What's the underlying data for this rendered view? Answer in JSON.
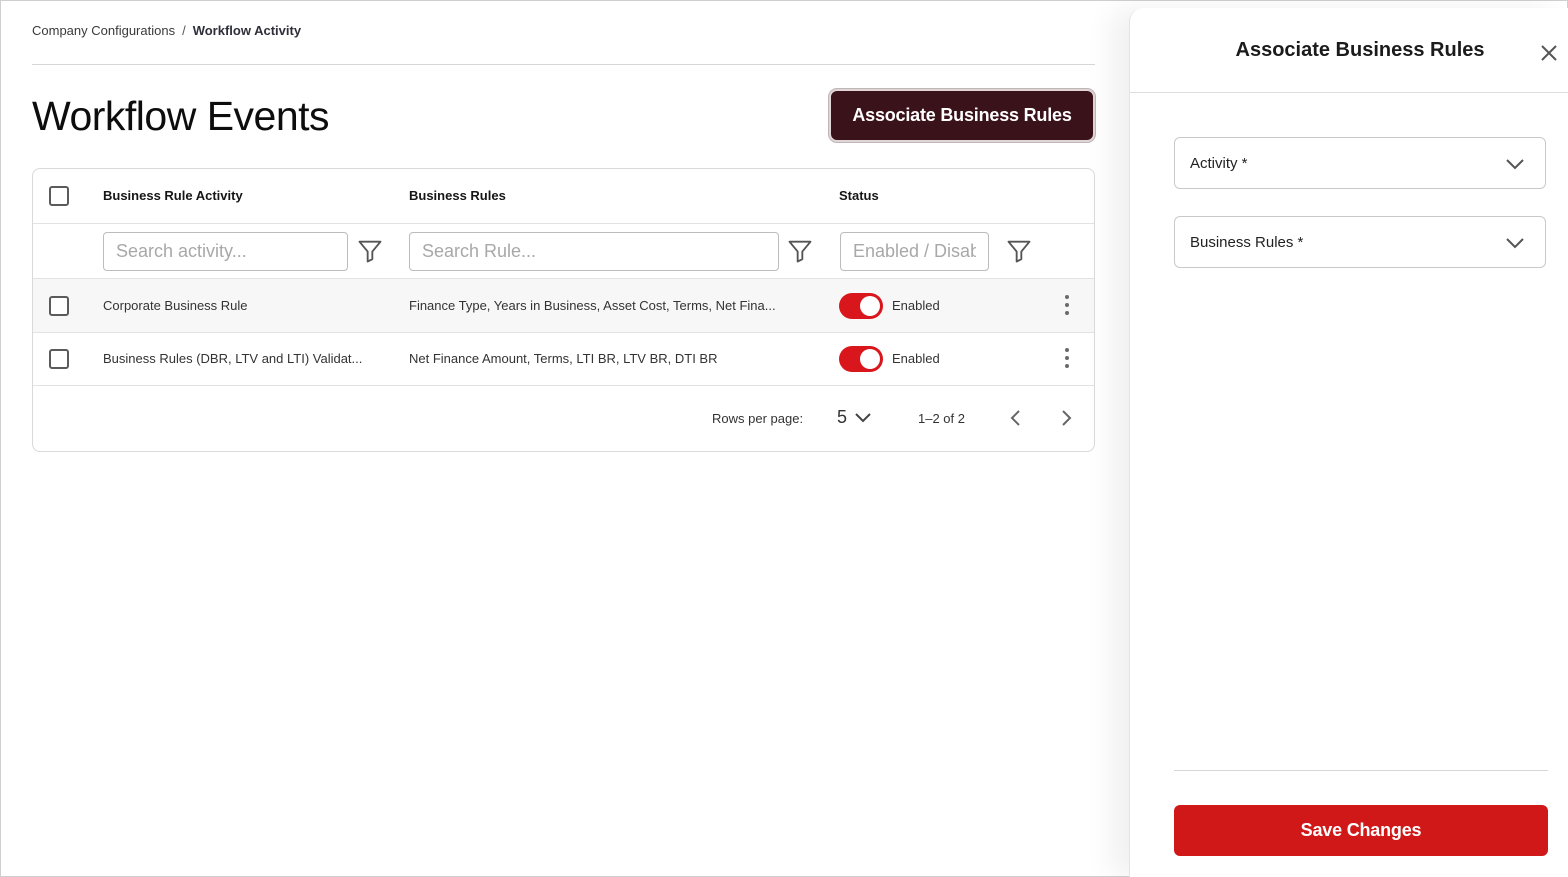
{
  "breadcrumb": {
    "parent": "Company Configurations",
    "separator": "/",
    "current": "Workflow Activity"
  },
  "page": {
    "title": "Workflow Events",
    "associate_button": "Associate Business Rules"
  },
  "table": {
    "columns": {
      "activity": "Business Rule Activity",
      "rules": "Business Rules",
      "status": "Status"
    },
    "filters": {
      "activity_placeholder": "Search activity...",
      "rules_placeholder": "Search Rule...",
      "status_placeholder": "Enabled / Disabled"
    },
    "rows": [
      {
        "activity": "Corporate Business Rule",
        "rules": "Finance Type, Years in Business, Asset Cost, Terms, Net Fina...",
        "enabled": true,
        "status": "Enabled"
      },
      {
        "activity": "Business Rules (DBR, LTV and LTI) Validat...",
        "rules": "Net Finance Amount, Terms, LTI BR, LTV BR, DTI BR",
        "enabled": true,
        "status": "Enabled"
      }
    ],
    "pagination": {
      "rows_per_page_label": "Rows per page:",
      "rows_per_page": "5",
      "range": "1–2 of 2"
    }
  },
  "drawer": {
    "title": "Associate Business Rules",
    "activity_select": "Activity *",
    "rules_select": "Business Rules *",
    "save_button": "Save Changes"
  },
  "colors": {
    "primary_dark": "#3a1219",
    "accent_red": "#d01818",
    "toggle_on": "#d9161b"
  },
  "icons": [
    "filter-icon",
    "kebab-menu-icon",
    "chevron-down-icon",
    "chevron-left-icon",
    "chevron-right-icon",
    "close-icon"
  ]
}
